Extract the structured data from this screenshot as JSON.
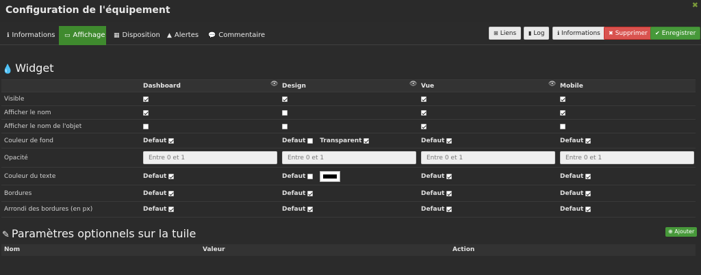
{
  "window": {
    "title": "Configuration de l'équipement",
    "close_glyph": "✖"
  },
  "tabs": [
    {
      "label": "Informations",
      "icon": "info-circle-icon",
      "active": false
    },
    {
      "label": "Affichage",
      "icon": "monitor-icon",
      "active": true
    },
    {
      "label": "Disposition",
      "icon": "grid-icon",
      "active": false
    },
    {
      "label": "Alertes",
      "icon": "warning-icon",
      "active": false
    },
    {
      "label": "Commentaire",
      "icon": "comment-icon",
      "active": false
    }
  ],
  "actions": {
    "liens": "Liens",
    "log": "Log",
    "informations": "Informations",
    "supprimer": "Supprimer",
    "enregistrer": "Enregistrer"
  },
  "widget": {
    "title": "Widget",
    "columns": [
      "Dashboard",
      "Design",
      "Vue",
      "Mobile"
    ],
    "rows": {
      "visible": "Visible",
      "afficher_nom": "Afficher le nom",
      "afficher_nom_objet": "Afficher le nom de l'objet",
      "couleur_fond": "Couleur de fond",
      "opacite": "Opacité",
      "couleur_texte": "Couleur du texte",
      "bordures": "Bordures",
      "arrondi": "Arrondi des bordures (en px)"
    },
    "defaut_label": "Defaut",
    "transparent_label": "Transparent",
    "opacity_placeholder": "Entre 0 et 1"
  },
  "optional": {
    "title": "Paramètres optionnels sur la tuile",
    "add_label": "Ajouter",
    "columns": {
      "nom": "Nom",
      "valeur": "Valeur",
      "action": "Action"
    }
  },
  "colors": {
    "accent_green": "#3f8a2e",
    "danger_red": "#d9534f",
    "background": "#2b2b2b"
  }
}
